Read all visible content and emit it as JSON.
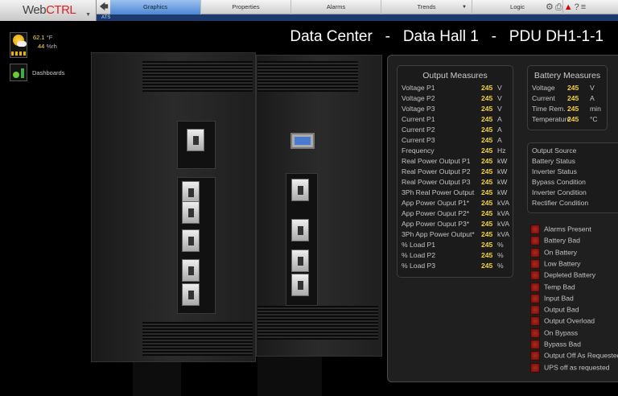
{
  "app": {
    "logo": "WebCTRL",
    "logo_prefix": "Web",
    "logo_suffix": "CTRL"
  },
  "nav": {
    "tabs": [
      {
        "label": "Graphics",
        "active": true
      },
      {
        "label": "Properties"
      },
      {
        "label": "Alarms"
      },
      {
        "label": "Trends"
      },
      {
        "label": "Logic"
      }
    ]
  },
  "breadcrumb": "ATS",
  "weather": {
    "temp": "62.1",
    "temp_unit": "°F",
    "humidity": "44",
    "humidity_unit": "%rh"
  },
  "dashboards_label": "Dashboards",
  "title": "Data Center   -   Data Hall 1   -   PDU DH1-1-1",
  "colors": {
    "accent_tab": "#4d86d4",
    "value": "#f2d33a",
    "led": "#9a1c14",
    "panel_bg": "#1f1f1f"
  },
  "output_measures": {
    "title": "Output Measures",
    "rows": [
      {
        "label": "Voltage P1",
        "value": "245",
        "unit": "V"
      },
      {
        "label": "Voltage P2",
        "value": "245",
        "unit": "V"
      },
      {
        "label": "Voltage P3",
        "value": "245",
        "unit": "V"
      },
      {
        "label": "Current P1",
        "value": "245",
        "unit": "A"
      },
      {
        "label": "Current P2",
        "value": "245",
        "unit": "A"
      },
      {
        "label": "Current P3",
        "value": "245",
        "unit": "A"
      },
      {
        "label": "Frequency",
        "value": "245",
        "unit": "Hz"
      },
      {
        "label": "Real Power Output P1",
        "value": "245",
        "unit": "kW"
      },
      {
        "label": "Real Power Output P2",
        "value": "245",
        "unit": "kW"
      },
      {
        "label": "Real Power Output P3",
        "value": "245",
        "unit": "kW"
      },
      {
        "label": "3Ph Real Power Output",
        "value": "245",
        "unit": "kW"
      },
      {
        "label": "App Power Ouput P1*",
        "value": "245",
        "unit": "kVA"
      },
      {
        "label": "App Power Ouput P2*",
        "value": "245",
        "unit": "kVA"
      },
      {
        "label": "App Power Ouput P3*",
        "value": "245",
        "unit": "kVA"
      },
      {
        "label": "3Ph App Power Output*",
        "value": "245",
        "unit": "kVA"
      },
      {
        "label": "% Load P1",
        "value": "245",
        "unit": "%"
      },
      {
        "label": "% Load P2",
        "value": "245",
        "unit": "%"
      },
      {
        "label": "% Load P3",
        "value": "245",
        "unit": "%"
      }
    ]
  },
  "battery_measures": {
    "title": "Battery Measures",
    "rows": [
      {
        "label": "Voltage",
        "value": "245",
        "unit": "V"
      },
      {
        "label": "Current",
        "value": "245",
        "unit": "A"
      },
      {
        "label": "Time Rem.",
        "value": "245",
        "unit": "min"
      },
      {
        "label": "Temperature",
        "value": "245",
        "unit": "°C"
      }
    ]
  },
  "status": [
    "Output Source",
    "Battery Status",
    "Inverter Status",
    "Bypass Condition",
    "Inverter Condition",
    "Rectifier Condition"
  ],
  "alarms": [
    "Alarms Present",
    "Battery Bad",
    "On Battery",
    "Low Battery",
    "Depleted Battery",
    "Temp Bad",
    "Input Bad",
    "Output Bad",
    "Output Overload",
    "On Bypass",
    "Bypass Bad",
    "Output Off As Requested",
    "UPS off as requested"
  ]
}
